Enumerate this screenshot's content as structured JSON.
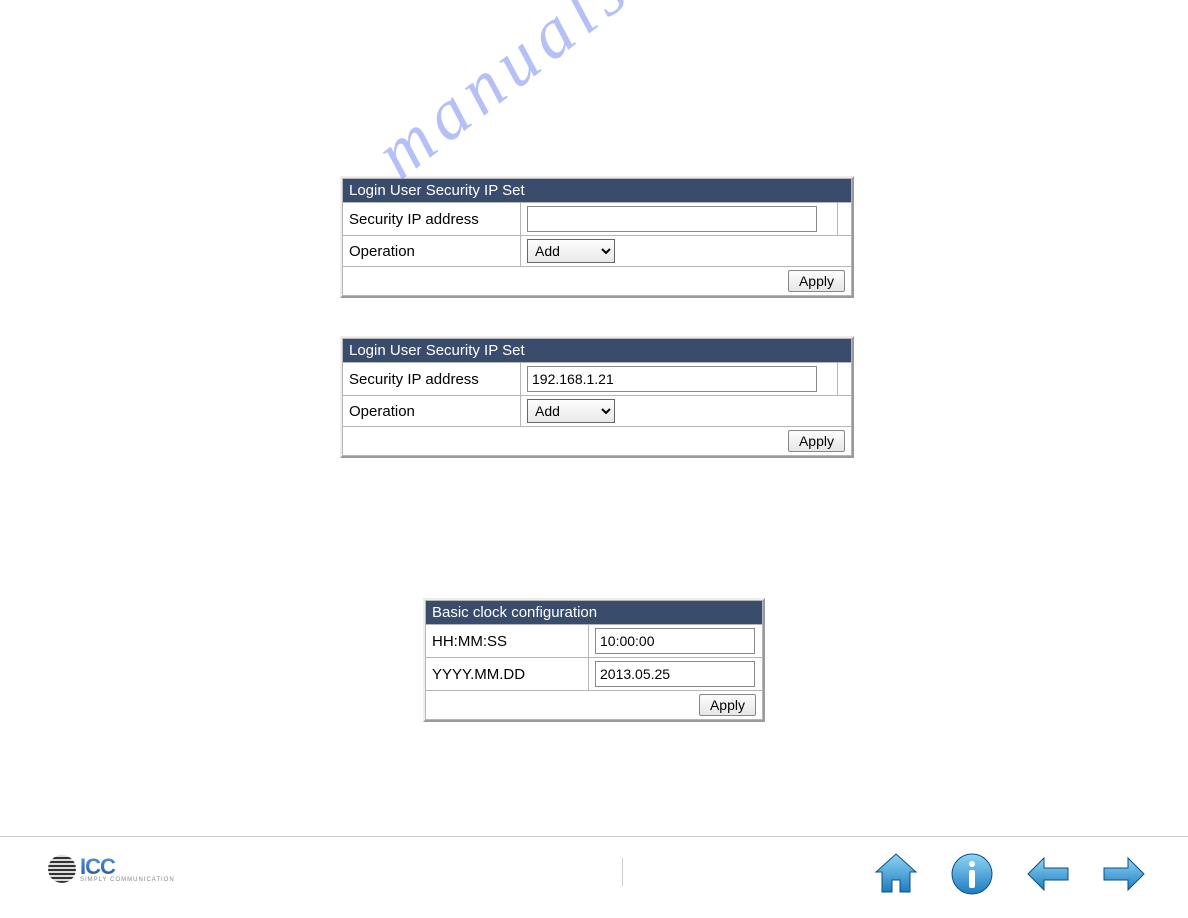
{
  "watermark_text": "manualshive.com",
  "panel1": {
    "title": "Login User Security IP Set",
    "ip_label": "Security IP address",
    "ip_value": "",
    "op_label": "Operation",
    "op_selected": "Add",
    "apply_label": "Apply"
  },
  "panel2": {
    "title": "Login User Security IP Set",
    "ip_label": "Security IP address",
    "ip_value": "192.168.1.21",
    "op_label": "Operation",
    "op_selected": "Add",
    "apply_label": "Apply"
  },
  "panel3": {
    "title": "Basic clock configuration",
    "time_label": "HH:MM:SS",
    "time_value": "10:00:00",
    "date_label": "YYYY.MM.DD",
    "date_value": "2013.05.25",
    "apply_label": "Apply"
  },
  "footer": {
    "logo_text": "ICC",
    "logo_sub": "SIMPLY COMMUNICATION"
  }
}
